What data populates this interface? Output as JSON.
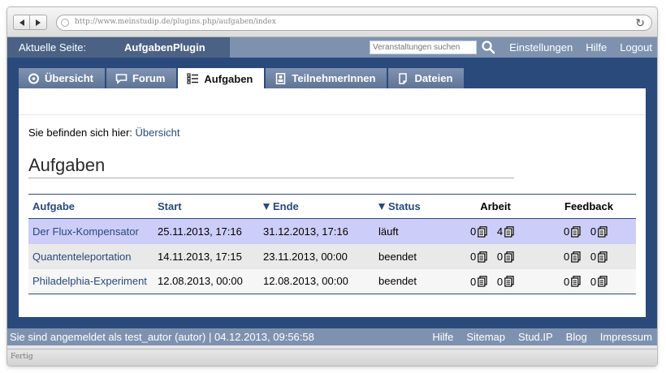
{
  "browser": {
    "url": "http://www.meinstudip.de/plugins.php/aufgaben/index",
    "status": "Fertig"
  },
  "header": {
    "breadcrumb_label": "Aktuelle Seite:",
    "breadcrumb_current": "AufgabenPlugin",
    "search_placeholder": "Veranstaltungen suchen",
    "links": [
      "Einstellungen",
      "Hilfe",
      "Logout"
    ]
  },
  "tabs": [
    {
      "label": "Übersicht",
      "icon": "overview-icon",
      "active": false
    },
    {
      "label": "Forum",
      "icon": "forum-icon",
      "active": false
    },
    {
      "label": "Aufgaben",
      "icon": "tasks-icon",
      "active": true
    },
    {
      "label": "TeilnehmerInnen",
      "icon": "participants-icon",
      "active": false
    },
    {
      "label": "Dateien",
      "icon": "files-icon",
      "active": false
    }
  ],
  "main": {
    "location_label": "Sie befinden sich hier:",
    "location_link": "Übersicht",
    "title": "Aufgaben",
    "table": {
      "headers": {
        "aufgabe": "Aufgabe",
        "start": "Start",
        "ende": "Ende",
        "status": "Status",
        "arbeit": "Arbeit",
        "feedback": "Feedback"
      },
      "rows": [
        {
          "name": "Der Flux-Kompensator",
          "start": "25.11.2013, 17:16",
          "ende": "31.12.2013, 17:16",
          "status": "läuft",
          "arbeit_a": "0",
          "arbeit_b": "4",
          "feedback_a": "0",
          "feedback_b": "0"
        },
        {
          "name": "Quantenteleportation",
          "start": "14.11.2013, 17:15",
          "ende": "23.11.2013, 00:00",
          "status": "beendet",
          "arbeit_a": "0",
          "arbeit_b": "0",
          "feedback_a": "0",
          "feedback_b": "0"
        },
        {
          "name": "Philadelphia-Experiment",
          "start": "12.08.2013, 00:00",
          "ende": "12.08.2013, 00:00",
          "status": "beendet",
          "arbeit_a": "0",
          "arbeit_b": "0",
          "feedback_a": "0",
          "feedback_b": "0"
        }
      ]
    }
  },
  "footer": {
    "login_info": "Sie sind angemeldet als test_autor (autor) | 04.12.2013, 09:56:58",
    "links": [
      "Hilfe",
      "Sitemap",
      "Stud.IP",
      "Blog",
      "Impressum"
    ]
  },
  "colors": {
    "header_bar": "#7e92b0",
    "crumb_bar": "#4b6285",
    "content_bg": "#2a4a7c",
    "link": "#28497c",
    "highlight_row": "#cdcdf9"
  }
}
